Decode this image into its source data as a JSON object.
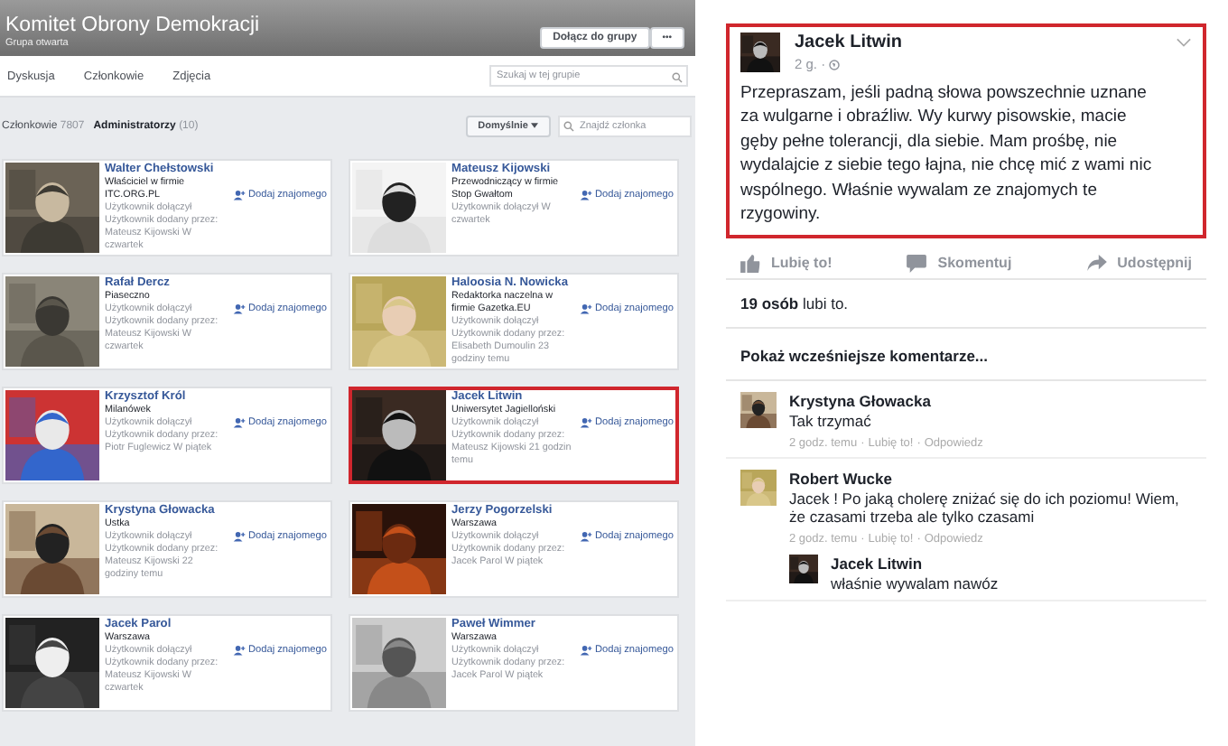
{
  "group": {
    "title": "Komitet Obrony Demokracji",
    "subtitle": "Grupa otwarta",
    "join_button": "Dołącz do grupy",
    "more_button": "•••"
  },
  "tabs": [
    {
      "label": "Dyskusja"
    },
    {
      "label": "Członkowie"
    },
    {
      "label": "Zdjęcia"
    }
  ],
  "group_search": {
    "placeholder": "Szukaj w tej grupie"
  },
  "member_filters": [
    {
      "label": "Członkowie",
      "count": "7807",
      "selected": false
    },
    {
      "label": "Administratorzy",
      "count": "(10)",
      "selected": true
    }
  ],
  "sort_button": "Domyślnie",
  "member_search": {
    "placeholder": "Znajdź członka"
  },
  "members": [
    {
      "name": "Walter Chełstowski",
      "role": "Właściciel w firmie ITC.ORG.PL",
      "meta": [
        "Użytkownik dołączył",
        "Użytkownik dodany przez: Mateusz Kijowski W czwartek"
      ],
      "action": "Dodaj znajomego",
      "highlighted": false
    },
    {
      "name": "Mateusz Kijowski",
      "role": "Przewodniczący w firmie Stop Gwałtom",
      "meta": [
        "Użytkownik dołączył W czwartek"
      ],
      "action": "Dodaj znajomego",
      "highlighted": false
    },
    {
      "name": "Rafał Dercz",
      "role": "Piaseczno",
      "meta": [
        "Użytkownik dołączył",
        "Użytkownik dodany przez: Mateusz Kijowski W czwartek"
      ],
      "action": "Dodaj znajomego",
      "highlighted": false
    },
    {
      "name": "Haloosia N. Nowicka",
      "role": "Redaktorka naczelna w firmie Gazetka.EU",
      "meta": [
        "Użytkownik dołączył",
        "Użytkownik dodany przez: Elisabeth Dumoulin 23 godziny temu"
      ],
      "action": "Dodaj znajomego",
      "highlighted": false
    },
    {
      "name": "Krzysztof Król",
      "role": "Milanówek",
      "meta": [
        "Użytkownik dołączył",
        "Użytkownik dodany przez: Piotr Fuglewicz W piątek"
      ],
      "action": "Dodaj znajomego",
      "highlighted": false
    },
    {
      "name": "Jacek Litwin",
      "role": "Uniwersytet Jagielloński",
      "meta": [
        "Użytkownik dołączył",
        "Użytkownik dodany przez: Mateusz Kijowski 21 godzin temu"
      ],
      "action": "Dodaj znajomego",
      "highlighted": true
    },
    {
      "name": "Krystyna Głowacka",
      "role": "Ustka",
      "meta": [
        "Użytkownik dołączył",
        "Użytkownik dodany przez: Mateusz Kijowski 22 godziny temu"
      ],
      "action": "Dodaj znajomego",
      "highlighted": false
    },
    {
      "name": "Jerzy Pogorzelski",
      "role": "Warszawa",
      "meta": [
        "Użytkownik dołączył",
        "Użytkownik dodany przez: Jacek Parol W piątek"
      ],
      "action": "Dodaj znajomego",
      "highlighted": false
    },
    {
      "name": "Jacek Parol",
      "role": "Warszawa",
      "meta": [
        "Użytkownik dołączył",
        "Użytkownik dodany przez: Mateusz Kijowski W czwartek"
      ],
      "action": "Dodaj znajomego",
      "highlighted": false
    },
    {
      "name": "Paweł Wimmer",
      "role": "Warszawa",
      "meta": [
        "Użytkownik dołączył",
        "Użytkownik dodany przez: Jacek Parol W piątek"
      ],
      "action": "Dodaj znajomego",
      "highlighted": false
    }
  ],
  "post": {
    "author": "Jacek Litwin",
    "time": "2 g. ·",
    "highlighted": true,
    "text": "Przepraszam, jeśli padną słowa powszechnie uznane za wulgarne i obraźliw. Wy kurwy pisowskie, macie gęby pełne tolerancji, dla siebie. Mam prośbę, nie wydalajcie z siebie tego łajna, nie chcę mić z wami nic wspólnego. Właśnie wywalam ze znajomych te rzygowiny.",
    "actions": [
      {
        "kind": "like",
        "label": "Lubię to!"
      },
      {
        "kind": "comment",
        "label": "Skomentuj"
      },
      {
        "kind": "share",
        "label": "Udostępnij"
      }
    ],
    "likes": "**19 osób** lubi to.",
    "more_comments": "Pokaż wcześniejsze komentarze...",
    "comments": [
      {
        "author": "Krystyna Głowacka",
        "text": "Tak trzymać",
        "separator": "·",
        "time": "2 godz. temu",
        "like": "Lubię to!",
        "reply": "Odpowiedz"
      },
      {
        "author": "Robert Wucke",
        "text": "Jacek ! Po jaką cholerę zniżać się do ich poziomu! Wiem, że czasami trzeba ale tylko czasami",
        "separator": "·",
        "time": "2 godz. temu",
        "like": "Lubię to!",
        "reply": "Odpowiedz",
        "replies": [
          {
            "author": "Jacek Litwin",
            "text": "właśnie wywalam nawóz"
          }
        ]
      }
    ]
  }
}
